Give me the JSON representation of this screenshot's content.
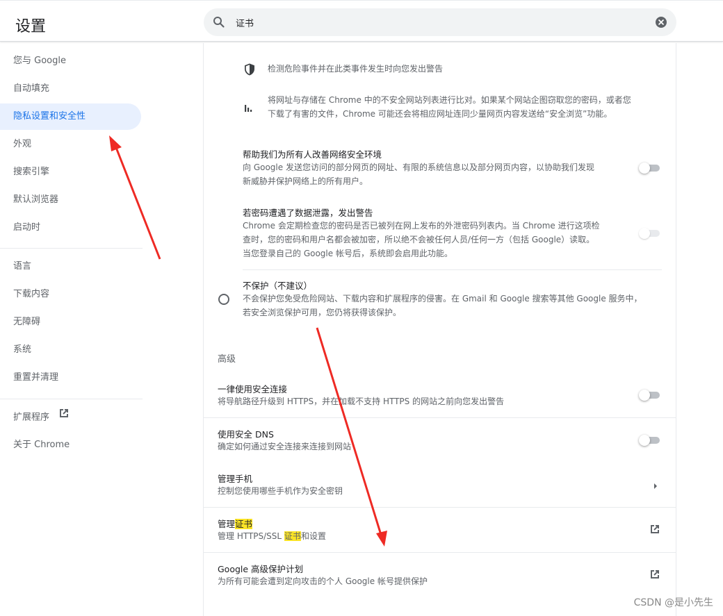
{
  "header": {
    "title": "设置",
    "search_value": "证书"
  },
  "sidebar": {
    "items": [
      {
        "label": "您与 Google"
      },
      {
        "label": "自动填充"
      },
      {
        "label": "隐私设置和安全性"
      },
      {
        "label": "外观"
      },
      {
        "label": "搜索引擎"
      },
      {
        "label": "默认浏览器"
      },
      {
        "label": "启动时"
      },
      {
        "label": "语言"
      },
      {
        "label": "下载内容"
      },
      {
        "label": "无障碍"
      },
      {
        "label": "系统"
      },
      {
        "label": "重置并清理"
      },
      {
        "label": "扩展程序"
      },
      {
        "label": "关于 Chrome"
      }
    ],
    "active_index": 2
  },
  "main": {
    "bullets": [
      {
        "icon": "shield-icon",
        "text": "检测危险事件并在此类事件发生时向您发出警告"
      },
      {
        "icon": "bar-chart-icon",
        "text_line1": "将网址与存储在 Chrome 中的不安全网站列表进行比对。如果某个网站企图窃取您的密码，或者您",
        "text_line2": "下载了有害的文件，Chrome 可能还会将相应网址连同少量网页内容发送给“安全浏览”功能。"
      }
    ],
    "help_improve": {
      "title": "帮助我们为所有人改善网络安全环境",
      "sub_line1": "向 Google 发送您访问的部分网页的网址、有限的系统信息以及部分网页内容，以协助我们发现",
      "sub_line2": "新威胁并保护网络上的所有用户。"
    },
    "password_leak": {
      "title": "若密码遭遇了数据泄露，发出警告",
      "sub_line1": "Chrome 会定期检查您的密码是否已被列在网上发布的外泄密码列表内。当 Chrome 进行这项检",
      "sub_line2": "查时，您的密码和用户名都会被加密，所以绝不会被任何人员/任何一方（包括 Google）读取。",
      "sub_line3": "当您登录自己的 Google 帐号后，系统即会启用此功能。"
    },
    "no_protection": {
      "title": "不保护（不建议）",
      "sub_line1": "不会保护您免受危险网站、下载内容和扩展程序的侵害。在 Gmail 和 Google 搜索等其他 Google 服务中，",
      "sub_line2": "若安全浏览保护可用，您仍将获得该保护。"
    },
    "advanced_label": "高级",
    "always_https": {
      "title": "一律使用安全连接",
      "sub": "将导航路径升级到 HTTPS，并在加载不支持 HTTPS 的网站之前向您发出警告"
    },
    "secure_dns": {
      "title": "使用安全 DNS",
      "sub": "确定如何通过安全连接来连接到网站"
    },
    "manage_phones": {
      "title": "管理手机",
      "sub": "控制您使用哪些手机作为安全密钥"
    },
    "manage_certs": {
      "title_prefix": "管理",
      "title_hl": "证书",
      "sub_prefix": "管理 HTTPS/SSL ",
      "sub_hl": "证书",
      "sub_suffix": "和设置"
    },
    "advanced_protection": {
      "title": "Google 高级保护计划",
      "sub": "为所有可能会遭到定向攻击的个人 Google 帐号提供保护"
    }
  },
  "watermark": "CSDN @是小先生",
  "colors": {
    "accent": "#1a73e8",
    "active_bg": "#e8f0fe",
    "highlight": "#fbe426",
    "annotation_arrow": "#ee2a24"
  }
}
